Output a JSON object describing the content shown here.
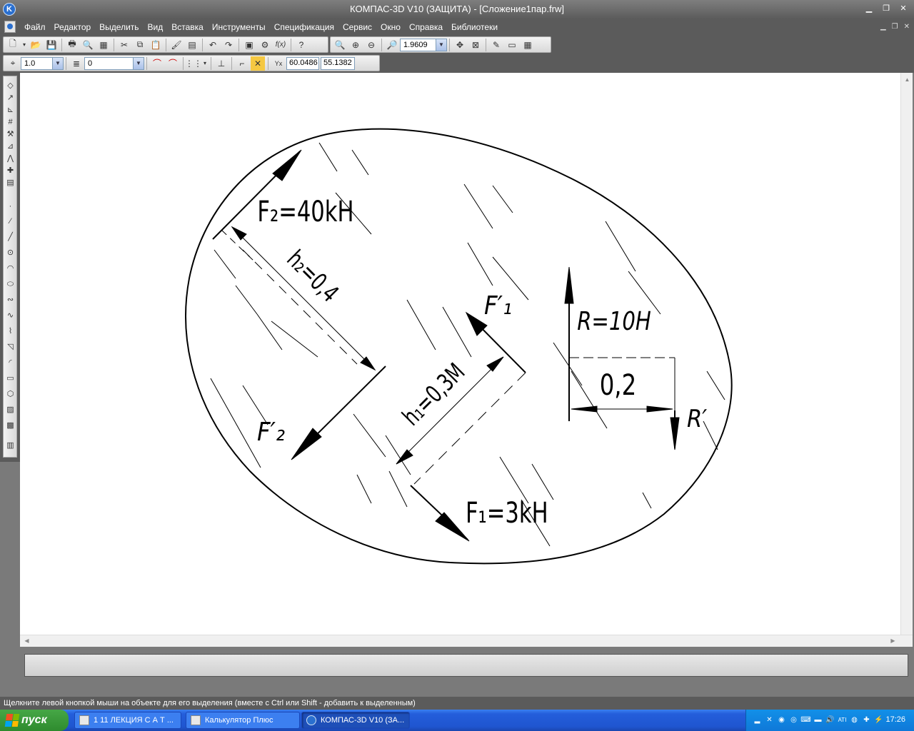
{
  "window": {
    "title": "КОМПАС-3D V10 (ЗАЩИТА) - [Сложение1пар.frw]",
    "app_icon_letter": "K"
  },
  "menu": {
    "items": [
      "Файл",
      "Редактор",
      "Выделить",
      "Вид",
      "Вставка",
      "Инструменты",
      "Спецификация",
      "Сервис",
      "Окно",
      "Справка",
      "Библиотеки"
    ]
  },
  "toolbar": {
    "zoom_value": "1.9609",
    "fx_label": "f(x)"
  },
  "toolbar2": {
    "scale_value": "1.0",
    "layer_value": "0",
    "coord_x": "60.0486",
    "coord_y": "55.1382"
  },
  "drawing": {
    "f2_label": "F₂=40kH",
    "h2_label": "h₂=0,4",
    "f1prime_label": "F′₁",
    "r_label": "R=10H",
    "dim_label": "0,2",
    "rprime_label": "R′",
    "h1_label": "h₁=0,3M",
    "f2prime_label": "F′₂",
    "f1_label": "F₁=3kH"
  },
  "status": {
    "message": "Щелкните левой кнопкой мыши на объекте для его выделения (вместе с Ctrl или Shift - добавить к выделенным)"
  },
  "taskbar": {
    "start_label": "пуск",
    "tasks": [
      "1 11 ЛЕКЦИЯ С А Т ...",
      "Калькулятор Плюс",
      "КОМПАС-3D V10 (ЗА..."
    ],
    "clock": "17:26"
  },
  "colors": {
    "chrome_dark": "#5b5b5b",
    "taskbar_blue": "#245edb",
    "start_green": "#3a9a3a"
  }
}
